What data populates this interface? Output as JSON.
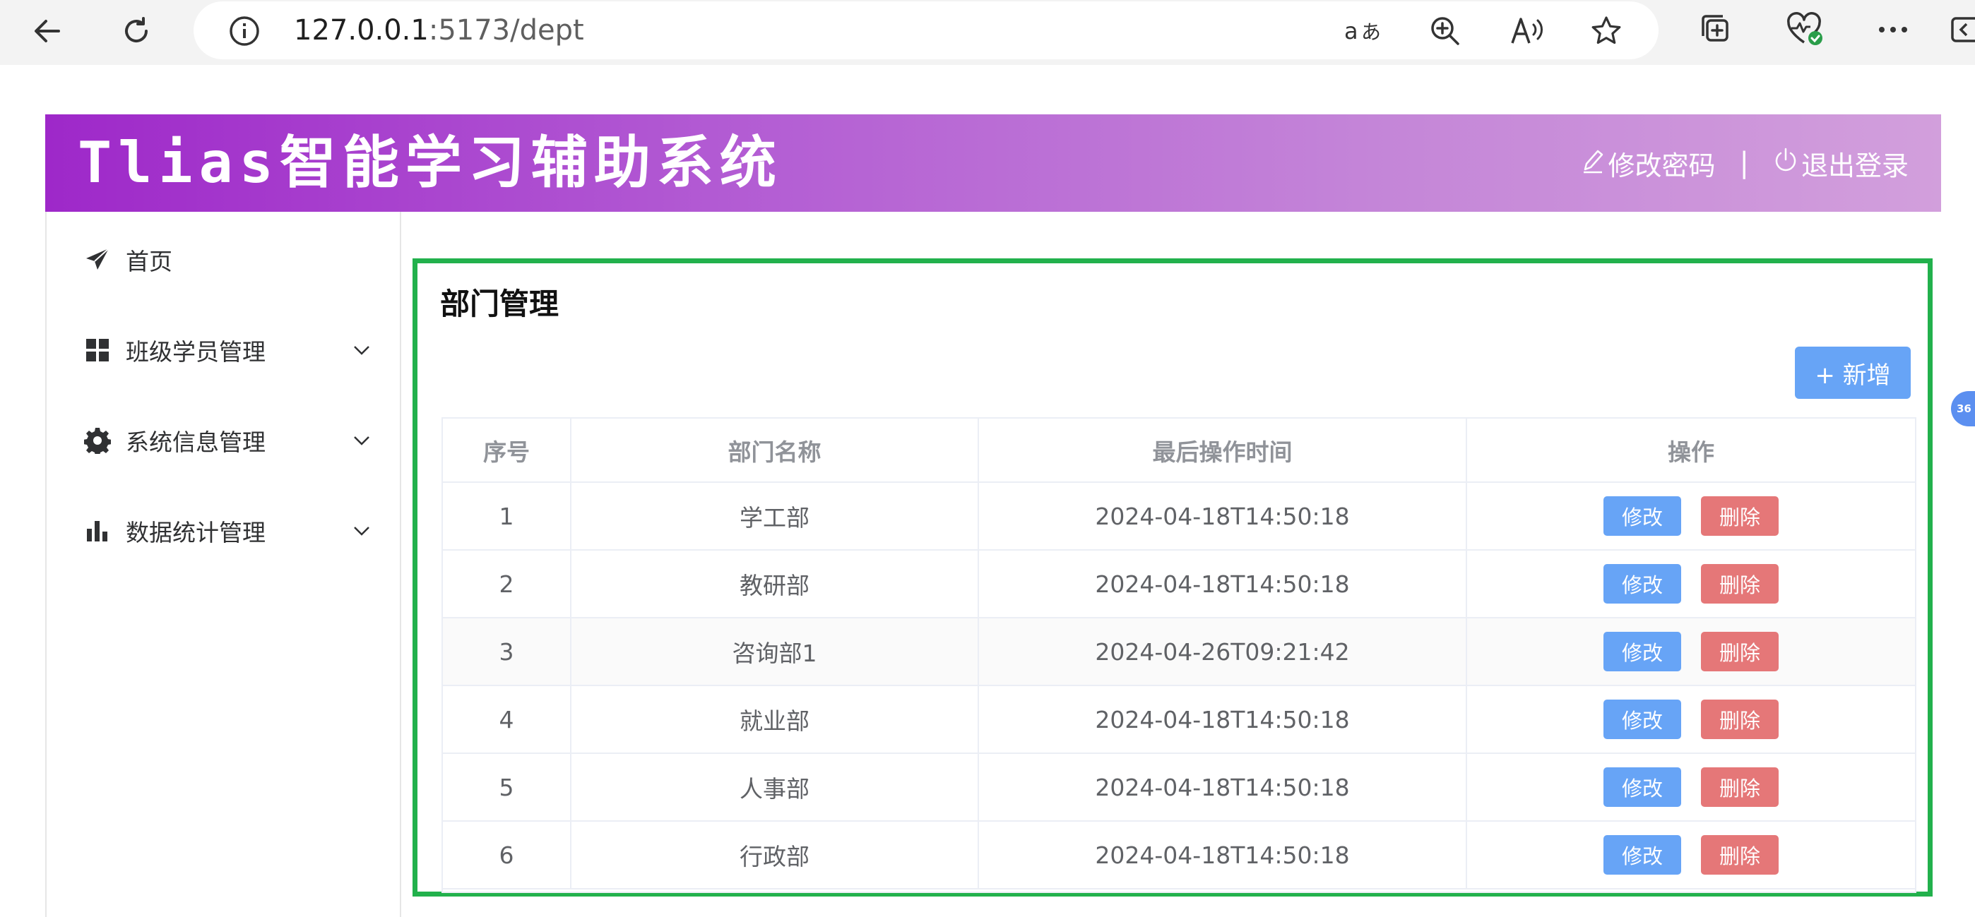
{
  "browser": {
    "url_host": "127.0.0.1",
    "url_path": ":5173/dept",
    "colors": {
      "chrome_bg": "#f3f3f3",
      "address_bg": "#ffffff"
    },
    "icons": [
      "back-arrow-icon",
      "refresh-icon",
      "info-icon",
      "read-aloud-translate-icon",
      "zoom-in-icon",
      "read-aloud-icon",
      "favorite-star-icon",
      "collections-icon",
      "browser-essentials-icon",
      "more-icon",
      "sidebar-toggle-icon"
    ]
  },
  "header": {
    "title": "Tlias智能学习辅助系统",
    "change_password": "修改密码",
    "separator": "|",
    "logout": "退出登录",
    "gradient_colors": [
      "#9e28c9",
      "#d29fdc"
    ]
  },
  "sidebar": {
    "items": [
      {
        "label": "首页",
        "icon": "paper-plane-icon",
        "expandable": false
      },
      {
        "label": "班级学员管理",
        "icon": "grid-icon",
        "expandable": true
      },
      {
        "label": "系统信息管理",
        "icon": "gear-icon",
        "expandable": true
      },
      {
        "label": "数据统计管理",
        "icon": "bar-chart-icon",
        "expandable": true
      }
    ]
  },
  "main": {
    "title": "部门管理",
    "add_button": "+ 新增",
    "border_color": "#22b14c",
    "table": {
      "columns": [
        "序号",
        "部门名称",
        "最后操作时间",
        "操作"
      ],
      "rows": [
        {
          "index": "1",
          "name": "学工部",
          "time": "2024-04-18T14:50:18"
        },
        {
          "index": "2",
          "name": "教研部",
          "time": "2024-04-18T14:50:18"
        },
        {
          "index": "3",
          "name": "咨询部1",
          "time": "2024-04-26T09:21:42"
        },
        {
          "index": "4",
          "name": "就业部",
          "time": "2024-04-18T14:50:18"
        },
        {
          "index": "5",
          "name": "人事部",
          "time": "2024-04-18T14:50:18"
        },
        {
          "index": "6",
          "name": "行政部",
          "time": "2024-04-18T14:50:18"
        }
      ],
      "edit_label": "修改",
      "delete_label": "删除",
      "edit_color": "#67a4f6",
      "delete_color": "#e57778"
    }
  },
  "floating": {
    "label": "36"
  }
}
